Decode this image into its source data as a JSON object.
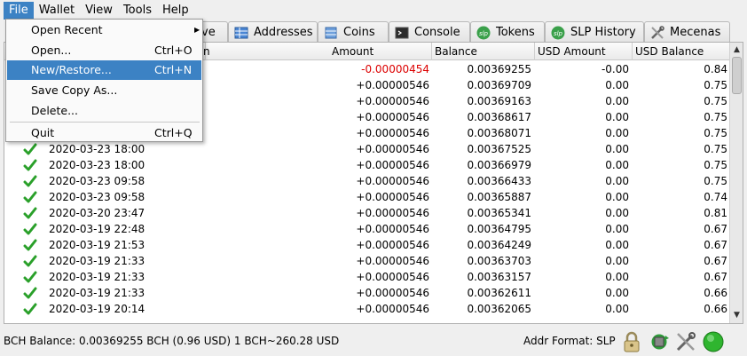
{
  "menubar": {
    "items": [
      {
        "label": "File",
        "active": true
      },
      {
        "label": "Wallet"
      },
      {
        "label": "View"
      },
      {
        "label": "Tools"
      },
      {
        "label": "Help"
      }
    ]
  },
  "tabs": [
    {
      "label": "ve",
      "icon": "receive-icon"
    },
    {
      "label": "Addresses",
      "icon": "addresses-icon"
    },
    {
      "label": "Coins",
      "icon": "coins-icon"
    },
    {
      "label": "Console",
      "icon": "console-icon"
    },
    {
      "label": "Tokens",
      "icon": "slp-icon"
    },
    {
      "label": "SLP History",
      "icon": "slp-icon"
    },
    {
      "label": "Mecenas",
      "icon": "tools-icon"
    }
  ],
  "table": {
    "headers": [
      "n",
      "Amount",
      "Balance",
      "USD Amount",
      "USD Balance"
    ],
    "rows": [
      {
        "date": "",
        "amount": "-0.00000454",
        "balance": "0.00369255",
        "usd_amount": "-0.00",
        "usd_balance": "0.84",
        "negative": true
      },
      {
        "date": "",
        "amount": "+0.00000546",
        "balance": "0.00369709",
        "usd_amount": "0.00",
        "usd_balance": "0.75"
      },
      {
        "date": "",
        "amount": "+0.00000546",
        "balance": "0.00369163",
        "usd_amount": "0.00",
        "usd_balance": "0.75"
      },
      {
        "date": "",
        "amount": "+0.00000546",
        "balance": "0.00368617",
        "usd_amount": "0.00",
        "usd_balance": "0.75"
      },
      {
        "date": "",
        "amount": "+0.00000546",
        "balance": "0.00368071",
        "usd_amount": "0.00",
        "usd_balance": "0.75"
      },
      {
        "date": "2020-03-23 18:00",
        "amount": "+0.00000546",
        "balance": "0.00367525",
        "usd_amount": "0.00",
        "usd_balance": "0.75"
      },
      {
        "date": "2020-03-23 18:00",
        "amount": "+0.00000546",
        "balance": "0.00366979",
        "usd_amount": "0.00",
        "usd_balance": "0.75"
      },
      {
        "date": "2020-03-23 09:58",
        "amount": "+0.00000546",
        "balance": "0.00366433",
        "usd_amount": "0.00",
        "usd_balance": "0.75"
      },
      {
        "date": "2020-03-23 09:58",
        "amount": "+0.00000546",
        "balance": "0.00365887",
        "usd_amount": "0.00",
        "usd_balance": "0.74"
      },
      {
        "date": "2020-03-20 23:47",
        "amount": "+0.00000546",
        "balance": "0.00365341",
        "usd_amount": "0.00",
        "usd_balance": "0.81"
      },
      {
        "date": "2020-03-19 22:48",
        "amount": "+0.00000546",
        "balance": "0.00364795",
        "usd_amount": "0.00",
        "usd_balance": "0.67"
      },
      {
        "date": "2020-03-19 21:53",
        "amount": "+0.00000546",
        "balance": "0.00364249",
        "usd_amount": "0.00",
        "usd_balance": "0.67"
      },
      {
        "date": "2020-03-19 21:33",
        "amount": "+0.00000546",
        "balance": "0.00363703",
        "usd_amount": "0.00",
        "usd_balance": "0.67"
      },
      {
        "date": "2020-03-19 21:33",
        "amount": "+0.00000546",
        "balance": "0.00363157",
        "usd_amount": "0.00",
        "usd_balance": "0.67"
      },
      {
        "date": "2020-03-19 21:33",
        "amount": "+0.00000546",
        "balance": "0.00362611",
        "usd_amount": "0.00",
        "usd_balance": "0.66"
      },
      {
        "date": "2020-03-19 20:14",
        "amount": "+0.00000546",
        "balance": "0.00362065",
        "usd_amount": "0.00",
        "usd_balance": "0.66"
      }
    ]
  },
  "status": {
    "balance_text": "BCH Balance: 0.00369255 BCH (0.96 USD)  1 BCH~260.28 USD",
    "addr_format": "Addr Format: SLP"
  },
  "file_menu": {
    "items": [
      {
        "label": "Open Recent",
        "shortcut": "",
        "submenu": true
      },
      {
        "label": "Open...",
        "shortcut": "Ctrl+O"
      },
      {
        "label": "New/Restore...",
        "shortcut": "Ctrl+N",
        "highlighted": true
      },
      {
        "label": "Save Copy As...",
        "shortcut": ""
      },
      {
        "label": "Delete...",
        "shortcut": ""
      },
      {
        "label": "Quit",
        "shortcut": "Ctrl+Q"
      }
    ]
  },
  "colors": {
    "accent": "#3c82c4",
    "negative": "#dc0000",
    "status_ok": "#2fb52f"
  }
}
